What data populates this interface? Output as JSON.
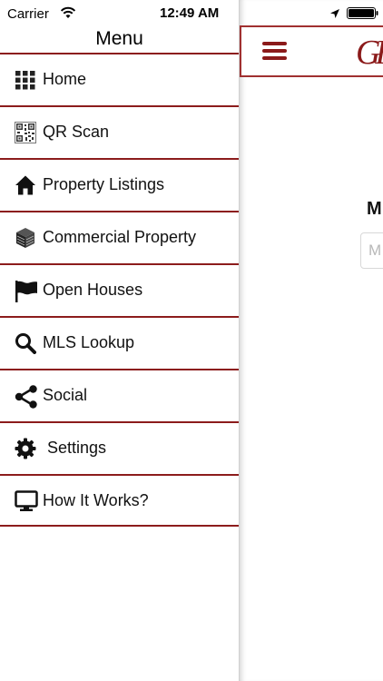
{
  "status_bar": {
    "carrier": "Carrier",
    "time": "12:49 AM"
  },
  "drawer": {
    "title": "Menu",
    "items": [
      {
        "label": "Home",
        "icon": "grid-icon"
      },
      {
        "label": "QR Scan",
        "icon": "qr-code-icon"
      },
      {
        "label": "Property Listings",
        "icon": "house-icon"
      },
      {
        "label": "Commercial Property",
        "icon": "building-icon"
      },
      {
        "label": "Open Houses",
        "icon": "flag-icon"
      },
      {
        "label": "MLS Lookup",
        "icon": "search-icon"
      },
      {
        "label": "Social",
        "icon": "share-icon"
      },
      {
        "label": "Settings",
        "icon": "gear-icon"
      },
      {
        "label": "How It Works?",
        "icon": "monitor-icon"
      }
    ]
  },
  "content": {
    "logo_text": "GH",
    "heading_partial": "M",
    "input_placeholder_partial": "M"
  },
  "colors": {
    "divider": "#8c1c1c",
    "brand": "#8b1a1a"
  }
}
